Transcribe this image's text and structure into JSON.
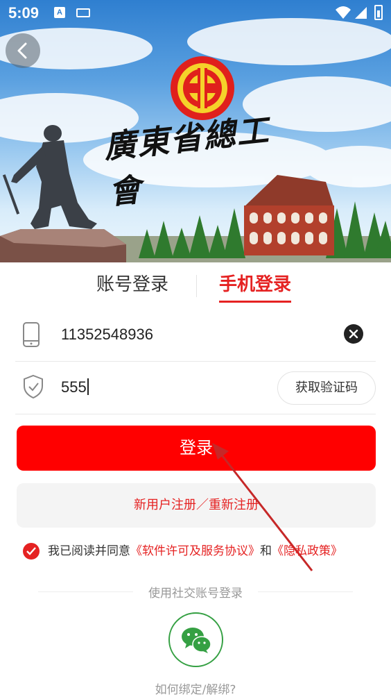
{
  "status_bar": {
    "time": "5:09",
    "input_indicator": "A"
  },
  "header": {
    "title": "廣東省總工會",
    "emblem_icon": "union-emblem-icon",
    "back_icon": "chevron-left-icon"
  },
  "tabs": [
    {
      "label": "账号登录",
      "active": false
    },
    {
      "label": "手机登录",
      "active": true
    }
  ],
  "form": {
    "phone_value": "11352548936",
    "code_value": "555",
    "get_code_label": "获取验证码"
  },
  "actions": {
    "login_label": "登录",
    "register_label": "新用户注册／重新注册"
  },
  "agreement": {
    "prefix": "我已阅读并同意",
    "terms_link": "《软件许可及服务协议》",
    "joiner": "和",
    "privacy_link": "《隐私政策》",
    "checked": true
  },
  "social": {
    "title": "使用社交账号登录",
    "wechat_icon": "wechat-icon",
    "help_link": "如何绑定/解绑?"
  },
  "colors": {
    "primary_red": "#ff0000",
    "text_red": "#e52222",
    "wechat_green": "#35a043"
  }
}
